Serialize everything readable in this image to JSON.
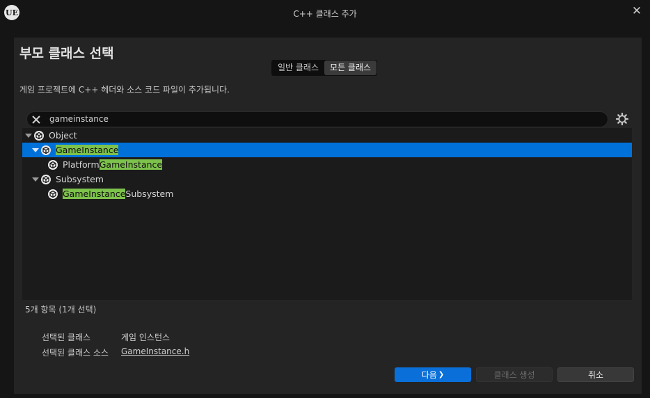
{
  "window": {
    "title": "C++ 클래스 추가",
    "logo": "UE",
    "close": "✕"
  },
  "page": {
    "title": "부모 클래스 선택",
    "description": "게임 프로젝트에 C++ 헤더와 소스 코드 파일이 추가됩니다."
  },
  "tabs": [
    {
      "label": "일반 클래스",
      "active": false
    },
    {
      "label": "모든 클래스",
      "active": true
    }
  ],
  "search": {
    "value": "gameinstance"
  },
  "tree": [
    {
      "parts": [
        {
          "text": "Object",
          "hl": false
        }
      ],
      "expanded": true,
      "selected": false
    },
    {
      "parts": [
        {
          "text": "GameInstance",
          "hl": true
        }
      ],
      "expanded": true,
      "selected": true
    },
    {
      "parts": [
        {
          "text": "Platform",
          "hl": false
        },
        {
          "text": "GameInstance",
          "hl": true
        }
      ],
      "expanded": null,
      "selected": false
    },
    {
      "parts": [
        {
          "text": "Subsystem",
          "hl": false
        }
      ],
      "expanded": true,
      "selected": false
    },
    {
      "parts": [
        {
          "text": "GameInstance",
          "hl": true
        },
        {
          "text": "Subsystem",
          "hl": false
        }
      ],
      "expanded": null,
      "selected": false
    }
  ],
  "status": {
    "count": "5개 항목 (1개 선택)"
  },
  "selection": {
    "class_label": "선택된 클래스",
    "class_value": "게임 인스턴스",
    "source_label": "선택된 클래스 소스",
    "source_value": "GameInstance.h"
  },
  "buttons": {
    "next": "다음",
    "next_icon": "❯",
    "create": "클래스 생성",
    "cancel": "취소"
  },
  "colors": {
    "selection": "#0071d9",
    "highlight": "#7dc24b",
    "primary_button": "#0a6fd8"
  }
}
